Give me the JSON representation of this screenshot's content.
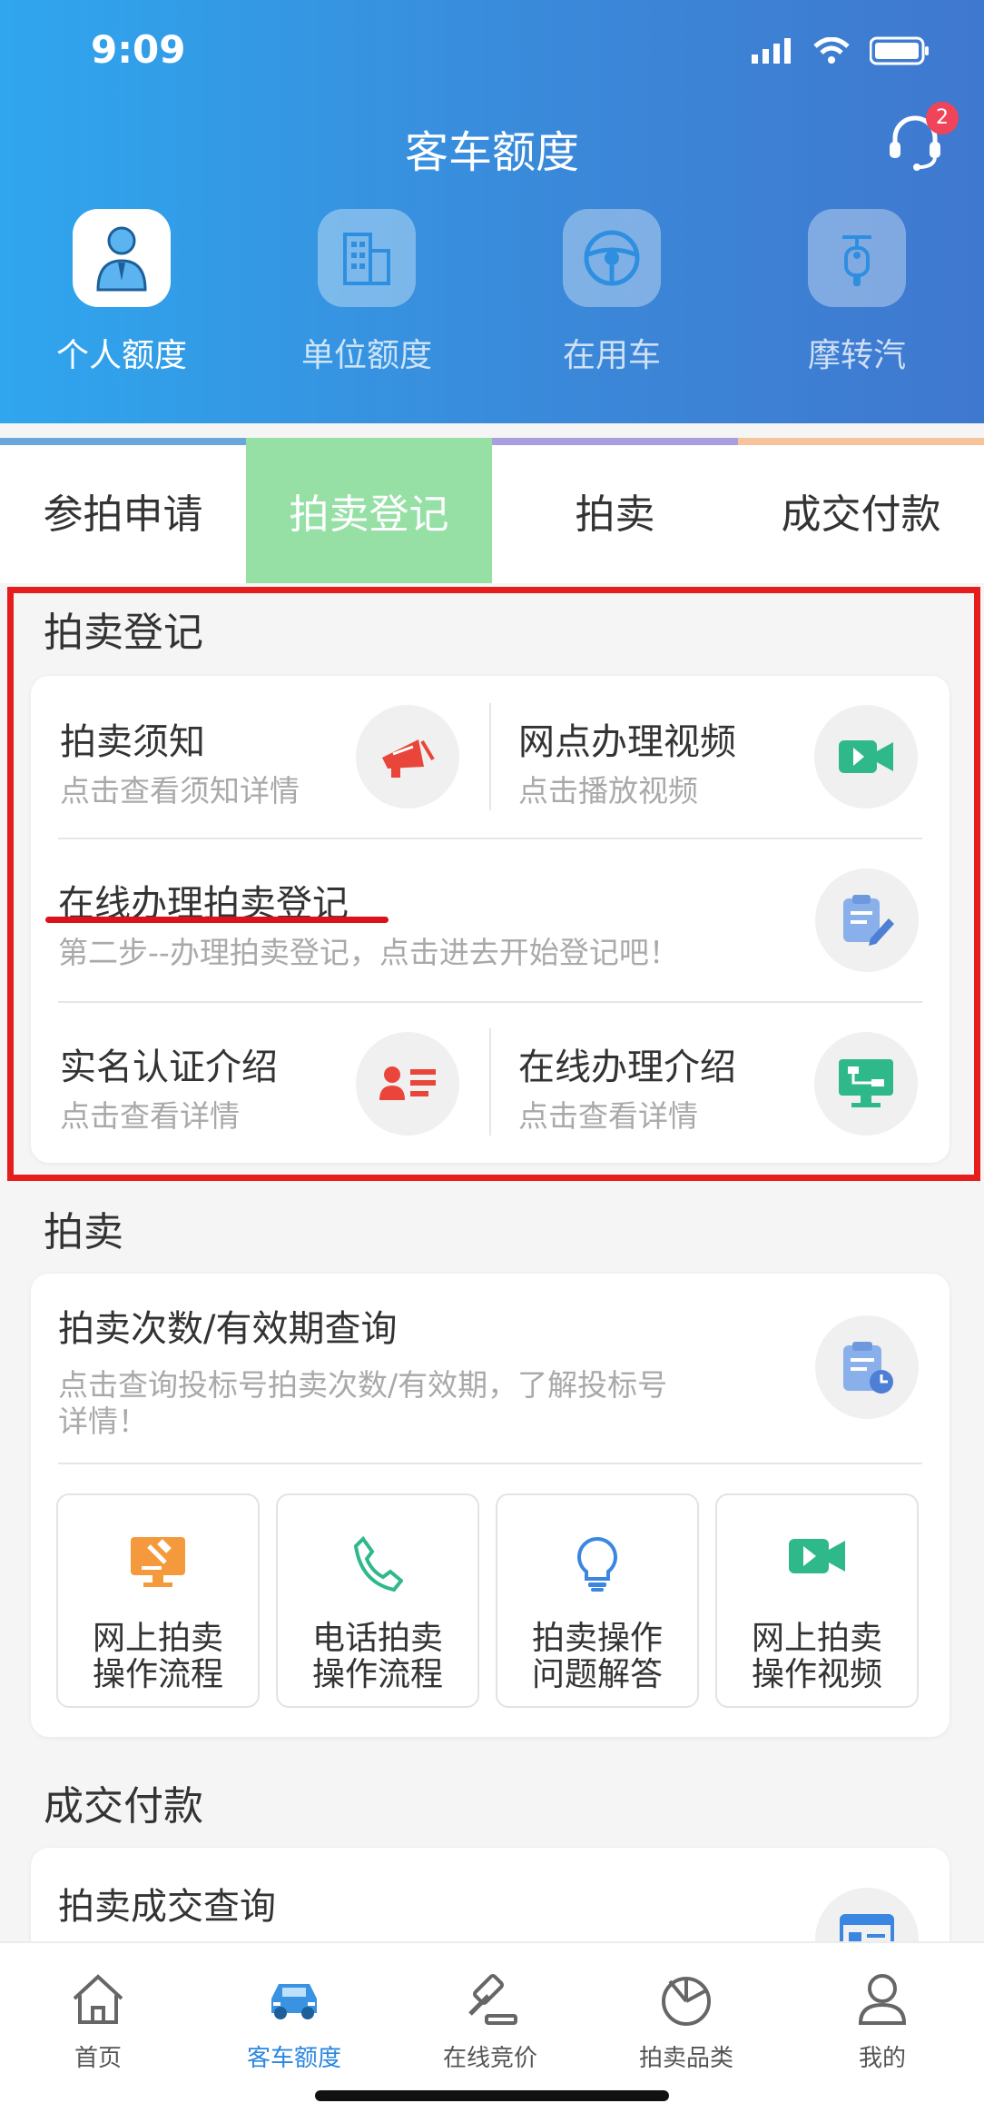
{
  "status_bar": {
    "time": "9:09"
  },
  "header": {
    "title": "客车额度",
    "support_badge": "2"
  },
  "categories": [
    {
      "label": "个人额度",
      "icon": "person-icon",
      "active": true
    },
    {
      "label": "单位额度",
      "icon": "building-icon",
      "active": false
    },
    {
      "label": "在用车",
      "icon": "steering-wheel-icon",
      "active": false
    },
    {
      "label": "摩转汽",
      "icon": "scooter-icon",
      "active": false
    }
  ],
  "tabs": [
    {
      "label": "参拍申请",
      "active": false
    },
    {
      "label": "拍卖登记",
      "active": true
    },
    {
      "label": "拍卖",
      "active": false
    },
    {
      "label": "成交付款",
      "active": false
    }
  ],
  "registration": {
    "title": "拍卖登记",
    "notice": {
      "title": "拍卖须知",
      "sub": "点击查看须知详情",
      "icon": "megaphone-icon"
    },
    "video": {
      "title": "网点办理视频",
      "sub": "点击播放视频",
      "icon": "video-camera-icon"
    },
    "online": {
      "title": "在线办理拍卖登记",
      "sub": "第二步--办理拍卖登记，点击进去开始登记吧！",
      "icon": "clipboard-edit-icon"
    },
    "realname": {
      "title": "实名认证介绍",
      "sub": "点击查看详情",
      "icon": "id-card-icon"
    },
    "online_intro": {
      "title": "在线办理介绍",
      "sub": "点击查看详情",
      "icon": "monitor-flow-icon"
    }
  },
  "auction": {
    "title": "拍卖",
    "query": {
      "title": "拍卖次数/有效期查询",
      "sub_line1": "点击查询投标号拍卖次数/有效期，了解投标号",
      "sub_line2": "详情！",
      "icon": "clipboard-clock-icon"
    },
    "tiles": [
      {
        "line1": "网上拍卖",
        "line2": "操作流程",
        "icon": "computer-gavel-icon"
      },
      {
        "line1": "电话拍卖",
        "line2": "操作流程",
        "icon": "phone-icon"
      },
      {
        "line1": "拍卖操作",
        "line2": "问题解答",
        "icon": "lightbulb-icon"
      },
      {
        "line1": "网上拍卖",
        "line2": "操作视频",
        "icon": "video-camera-icon"
      }
    ]
  },
  "payment": {
    "title": "成交付款",
    "query": {
      "title": "拍卖成交查询",
      "icon": "browser-list-icon"
    }
  },
  "bottom_nav": [
    {
      "label": "首页",
      "icon": "home-icon",
      "active": false
    },
    {
      "label": "客车额度",
      "icon": "car-icon",
      "active": true
    },
    {
      "label": "在线竞价",
      "icon": "gavel-icon",
      "active": false
    },
    {
      "label": "拍卖品类",
      "icon": "category-icon",
      "active": false
    },
    {
      "label": "我的",
      "icon": "user-icon",
      "active": false
    }
  ],
  "colors": {
    "header_start": "#2fa6ee",
    "header_end": "#3f78cf",
    "active_tab": "#96e0a6",
    "highlight": "#e51d1d",
    "accent_blue": "#2c87e0"
  }
}
